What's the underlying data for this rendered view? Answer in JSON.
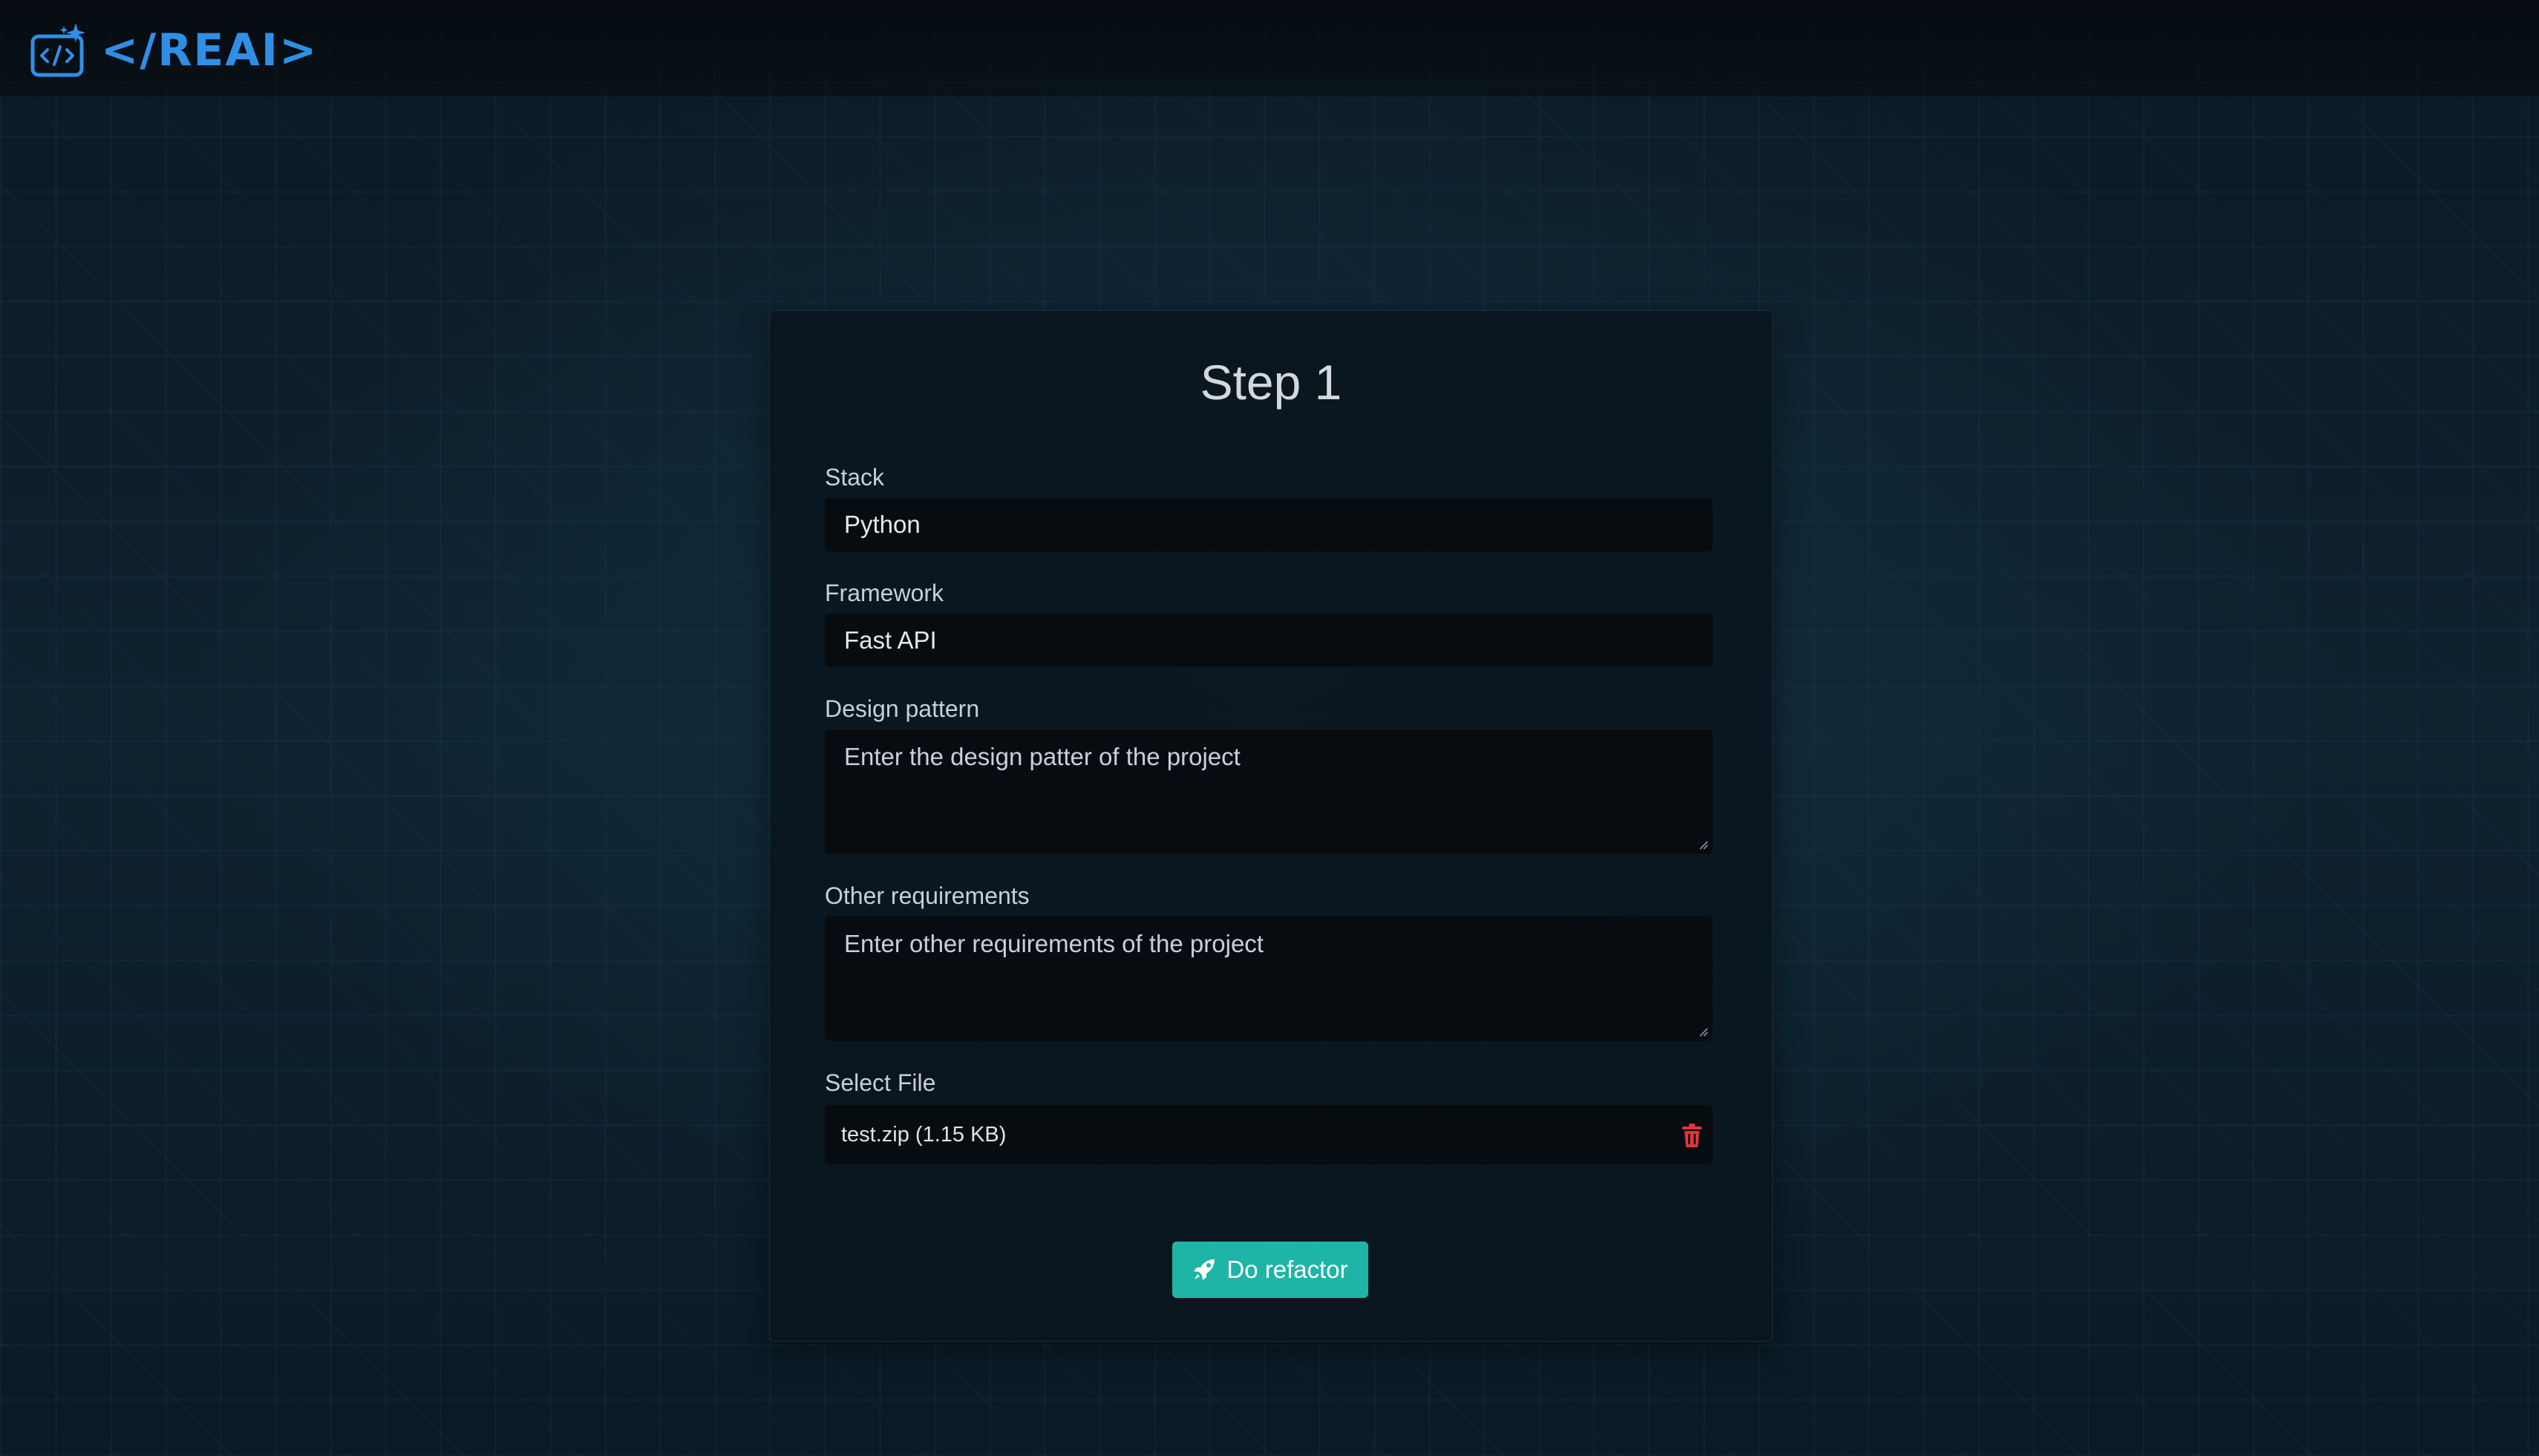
{
  "header": {
    "logo_text": "</REAI>",
    "logo_icon": "code-sparkle-icon"
  },
  "form": {
    "title": "Step 1",
    "stack": {
      "label": "Stack",
      "value": "Python"
    },
    "framework": {
      "label": "Framework",
      "value": "Fast API"
    },
    "design_pattern": {
      "label": "Design pattern",
      "placeholder": "Enter the design patter of the project"
    },
    "other_requirements": {
      "label": "Other requirements",
      "placeholder": "Enter other requirements of the project"
    },
    "file": {
      "label": "Select File",
      "value": "test.zip (1.15 KB)",
      "delete_icon": "trash-icon"
    },
    "submit": {
      "label": "Do refactor",
      "icon": "rocket-icon"
    }
  },
  "colors": {
    "brand": "#2f8fe6",
    "accent": "#1fb5a6",
    "danger": "#e0343a"
  }
}
